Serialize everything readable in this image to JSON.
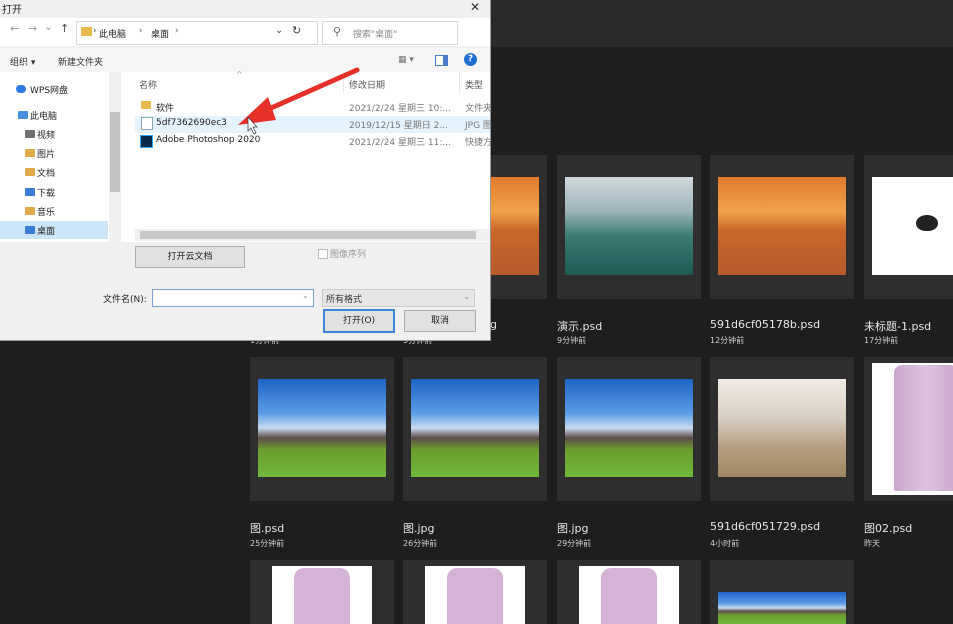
{
  "dialog": {
    "title": "打开",
    "close_glyph": "✕",
    "nav": {
      "back": "←",
      "forward": "→",
      "up": "↑",
      "recent": "⌄"
    },
    "address": {
      "crumbs": [
        "此电脑",
        "桌面"
      ],
      "sep": "›",
      "dropdown": "⌄"
    },
    "refresh": "↻",
    "search": {
      "icon": "⚲",
      "placeholder": "搜索\"桌面\""
    },
    "toolbar": {
      "organize": "组织 ▾",
      "new_folder": "新建文件夹",
      "view": "▦ ▾",
      "help": "?"
    },
    "nav_pane": [
      {
        "label": "WPS网盘",
        "icon": "cloud-icon",
        "color": "#2f7ae5"
      },
      {
        "label": "此电脑",
        "icon": "computer-icon",
        "color": "#4a90e2"
      },
      {
        "label": "视频",
        "icon": "video-icon",
        "color": "#6f6f6f"
      },
      {
        "label": "图片",
        "icon": "picture-icon",
        "color": "#e0a94a"
      },
      {
        "label": "文档",
        "icon": "document-icon",
        "color": "#e0a94a"
      },
      {
        "label": "下载",
        "icon": "download-icon",
        "color": "#3a7bd5"
      },
      {
        "label": "音乐",
        "icon": "music-icon",
        "color": "#e0a94a"
      },
      {
        "label": "桌面",
        "icon": "desktop-icon",
        "color": "#3a7bd5"
      }
    ],
    "columns": {
      "name": "名称",
      "date": "修改日期",
      "type": "类型",
      "sort_glyph": "^"
    },
    "files": [
      {
        "name": "软件",
        "date": "2021/2/24 星期三 10:...",
        "type": "文件夹",
        "icon": "folder-icon"
      },
      {
        "name": "5df7362690ec3",
        "date": "2019/12/15 星期日 2...",
        "type": "JPG 图",
        "icon": "jpg-file-icon"
      },
      {
        "name": "Adobe Photoshop 2020",
        "date": "2021/2/24 星期三 11:...",
        "type": "快捷方",
        "icon": "photoshop-shortcut-icon"
      }
    ],
    "open_cloud_doc": "打开云文档",
    "image_sequence": "图像序列",
    "filename_label": "文件名(N):",
    "filename_value": "",
    "filter_value": "所有格式",
    "open_button": "打开(O)",
    "cancel_button": "取消"
  },
  "recent_files": [
    {
      "name": "",
      "time": "",
      "image": "desert"
    },
    {
      "name": "演示.psd",
      "time": "9分钟前",
      "image": "mountain"
    },
    {
      "name": "591d6cf05178b.psd",
      "time": "12分钟前",
      "image": "desert"
    },
    {
      "name": "未标题-1.psd",
      "time": "17分钟前",
      "image": "white"
    },
    {
      "name": "图.psd",
      "time": "25分钟前",
      "image": "castle"
    },
    {
      "name": "图.jpg",
      "time": "26分钟前",
      "image": "castle"
    },
    {
      "name": "图.jpg",
      "time": "29分钟前",
      "image": "castle"
    },
    {
      "name": "591d6cf051729.psd",
      "time": "4小时前",
      "image": "dune"
    },
    {
      "name": "图02.psd",
      "time": "昨天",
      "image": "shirt"
    }
  ],
  "partial_labels": {
    "name_fragment": "g",
    "time_a": "1分钟前",
    "time_b": "5分钟前"
  },
  "colors": {
    "accent": "#1e6fd0",
    "annotation_arrow": "#e8302a",
    "ps_background": "#1e1e1e"
  }
}
